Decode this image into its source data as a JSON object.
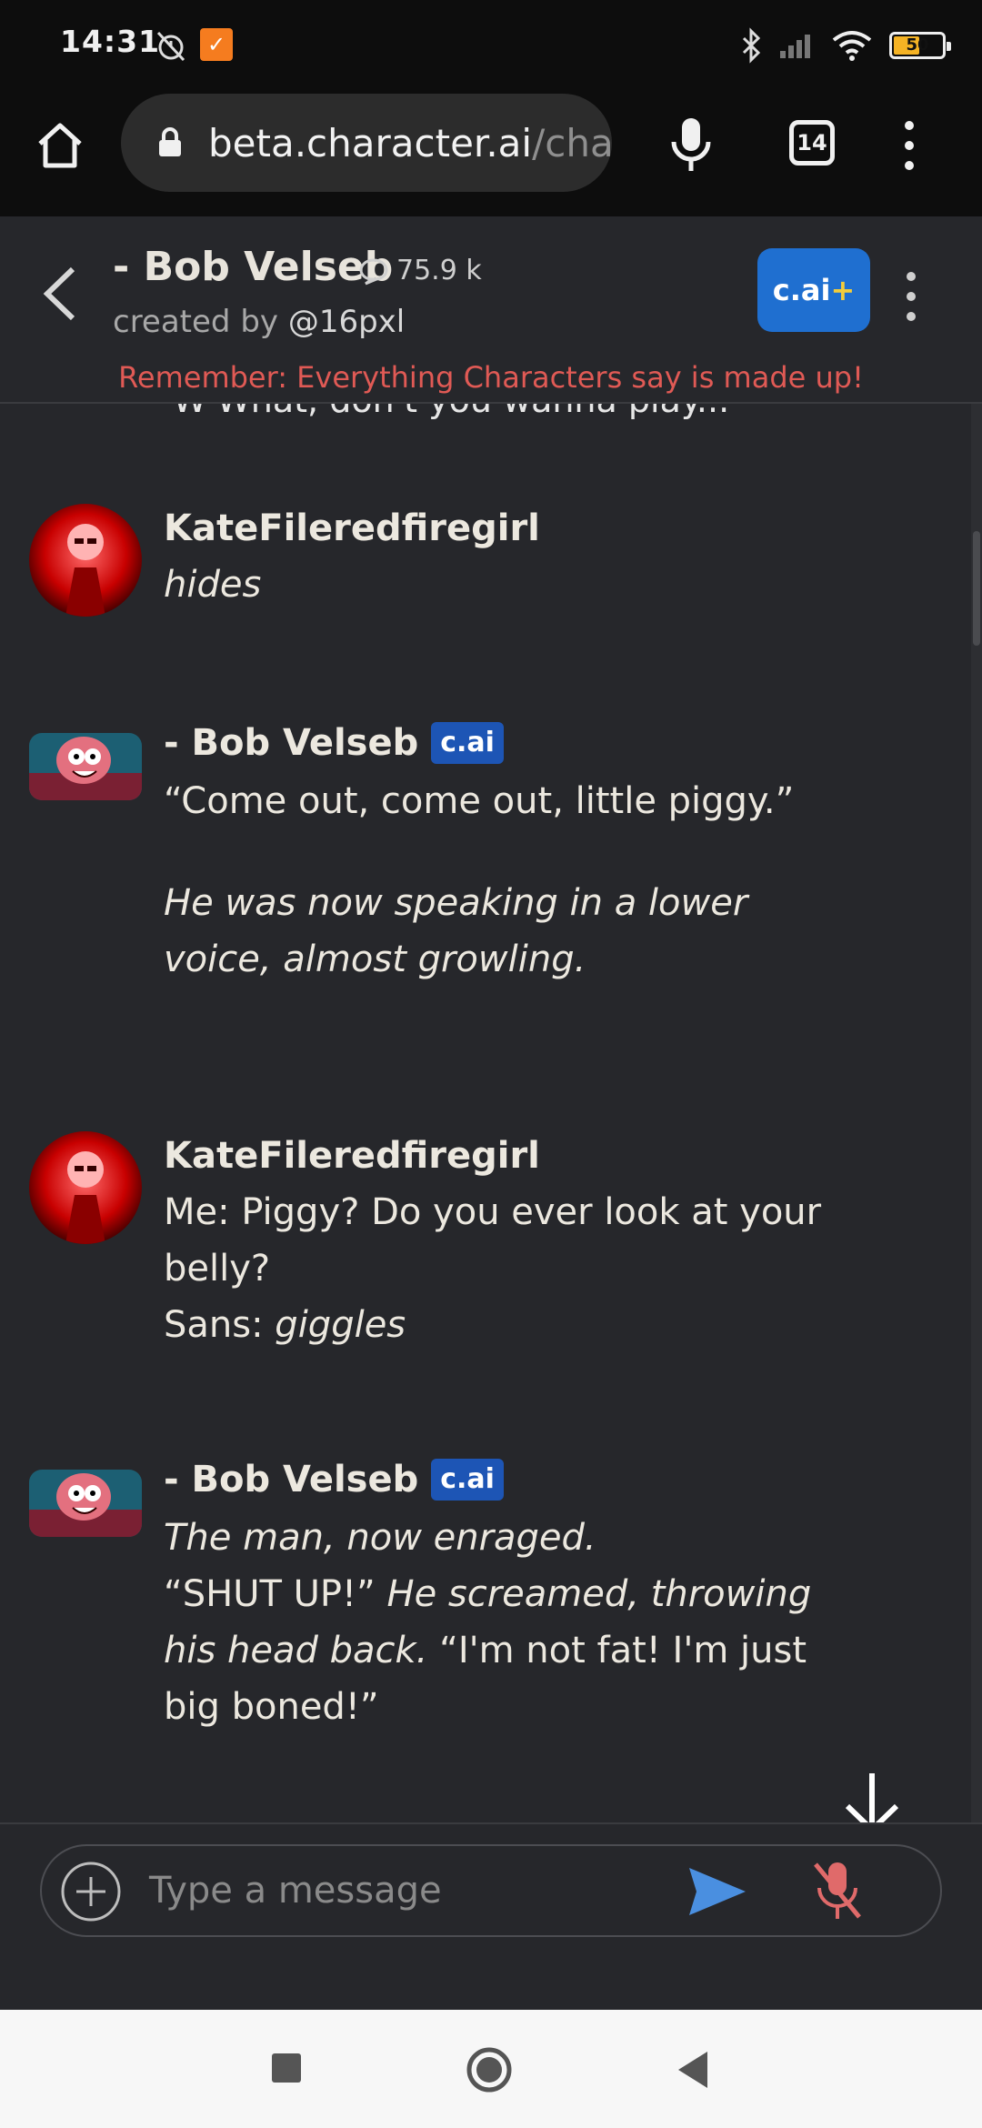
{
  "status_bar": {
    "time": "14:31",
    "app_icon_glyph": "✓",
    "battery_level": "50",
    "icons": [
      "alarm-off-icon",
      "app-notification-icon",
      "bluetooth-icon",
      "signal-icon",
      "wifi-icon",
      "battery-icon"
    ]
  },
  "browser": {
    "url_domain": "beta.character.ai",
    "url_path": "/chat",
    "tab_count": "14"
  },
  "header": {
    "character_name": "- Bob Velseb",
    "chat_count": "75.9 k",
    "created_by_prefix": "created by ",
    "creator": "@16pxl",
    "plus_button": "c.ai",
    "plus_mark": "+",
    "disclaimer": "Remember: Everything Characters say is made up!"
  },
  "chat": {
    "partial_text": "W-What, don't you wanna play...",
    "messages": [
      {
        "author": "KateFileredfiregirl",
        "line1_italic": "hides"
      },
      {
        "author": "- Bob Velseb",
        "tag": "c.ai",
        "line1": "“Come out, come out, little piggy.”",
        "para2_italic": "He was now speaking in a lower voice, almost growling."
      },
      {
        "author": "KateFileredfiregirl",
        "line1": "Me: Piggy? Do you ever look at your belly?",
        "line2_prefix": "Sans: ",
        "line2_italic": "giggles"
      },
      {
        "author": "- Bob Velseb",
        "tag": "c.ai",
        "line1_italic": "The man, now enraged.",
        "line2_quote": "“SHUT UP!”",
        "line2_italic": " He screamed, throwing his head back.",
        "line2_quote2": " “I'm not fat! I'm just big boned!”"
      }
    ]
  },
  "input": {
    "placeholder": "Type a message"
  },
  "colors": {
    "background": "#26272b",
    "accent_blue": "#1f6fd0",
    "disclaimer_red": "#e05a55",
    "send_blue": "#4a8fe0",
    "mic_off_red": "#e06a6a"
  }
}
